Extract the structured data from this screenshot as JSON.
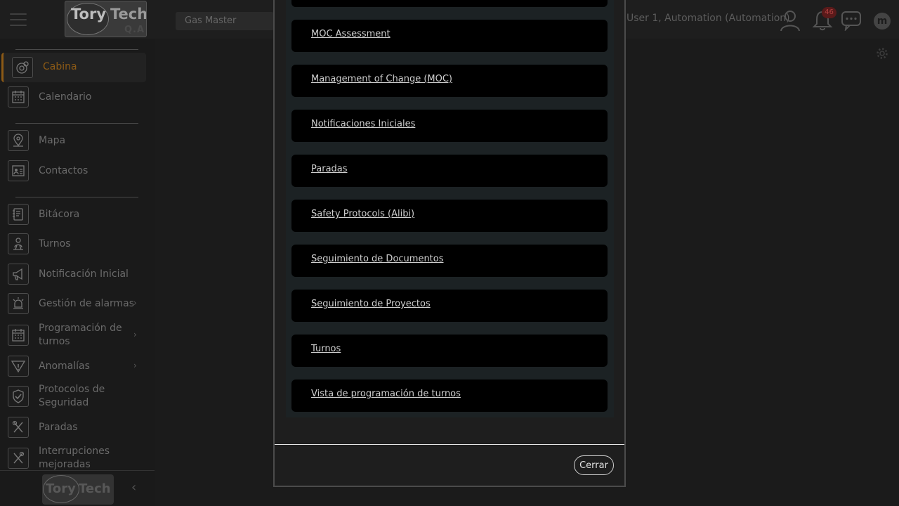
{
  "header": {
    "logo_text_1": "Tory",
    "logo_text_2": "Tech",
    "logo_sub": "Q.A",
    "project": "Gas Master",
    "user": "User 1, Automation (Automation)",
    "notifications_count": "46",
    "icons": [
      "menu-icon",
      "user-icon",
      "bell-icon",
      "chat-icon",
      "m-icon",
      "gear-icon"
    ]
  },
  "sidebar": {
    "items": [
      {
        "label": "Cabina",
        "icon": "cabin-icon",
        "active": true
      },
      {
        "label": "Calendario",
        "icon": "calendar-icon"
      },
      {
        "label": "Mapa",
        "icon": "map-pin-icon"
      },
      {
        "label": "Contactos",
        "icon": "contact-card-icon"
      },
      {
        "label": "Bitácora",
        "icon": "logbook-icon"
      },
      {
        "label": "Turnos",
        "icon": "shift-icon"
      },
      {
        "label": "Notificación Inicial",
        "icon": "megaphone-icon"
      },
      {
        "label": "Gestión de alarmas",
        "icon": "siren-icon",
        "chevron": "›"
      },
      {
        "label": "Programación de turnos",
        "icon": "calendar-grid-icon",
        "chevron": "›"
      },
      {
        "label": "Anomalías",
        "icon": "warning-icon",
        "chevron": "›"
      },
      {
        "label": "Protocolos de Seguridad",
        "icon": "shield-check-icon"
      },
      {
        "label": "Paradas",
        "icon": "wrench-icon"
      },
      {
        "label": "Interrupciones mejoradas",
        "icon": "tools-icon"
      }
    ],
    "footer": {
      "logo_text_1": "Tory",
      "logo_text_2": "Tech",
      "collapse": "‹"
    }
  },
  "modal": {
    "items": [
      "MOC Assessment",
      "Management of Change (MOC)",
      "Notificaciones Iniciales",
      "Paradas",
      "Safety Protocols (Alibi)",
      "Seguimiento de Documentos",
      "Seguimiento de Proyectos",
      "Turnos",
      "Vista de programación de turnos"
    ],
    "close_label": "Cerrar"
  }
}
